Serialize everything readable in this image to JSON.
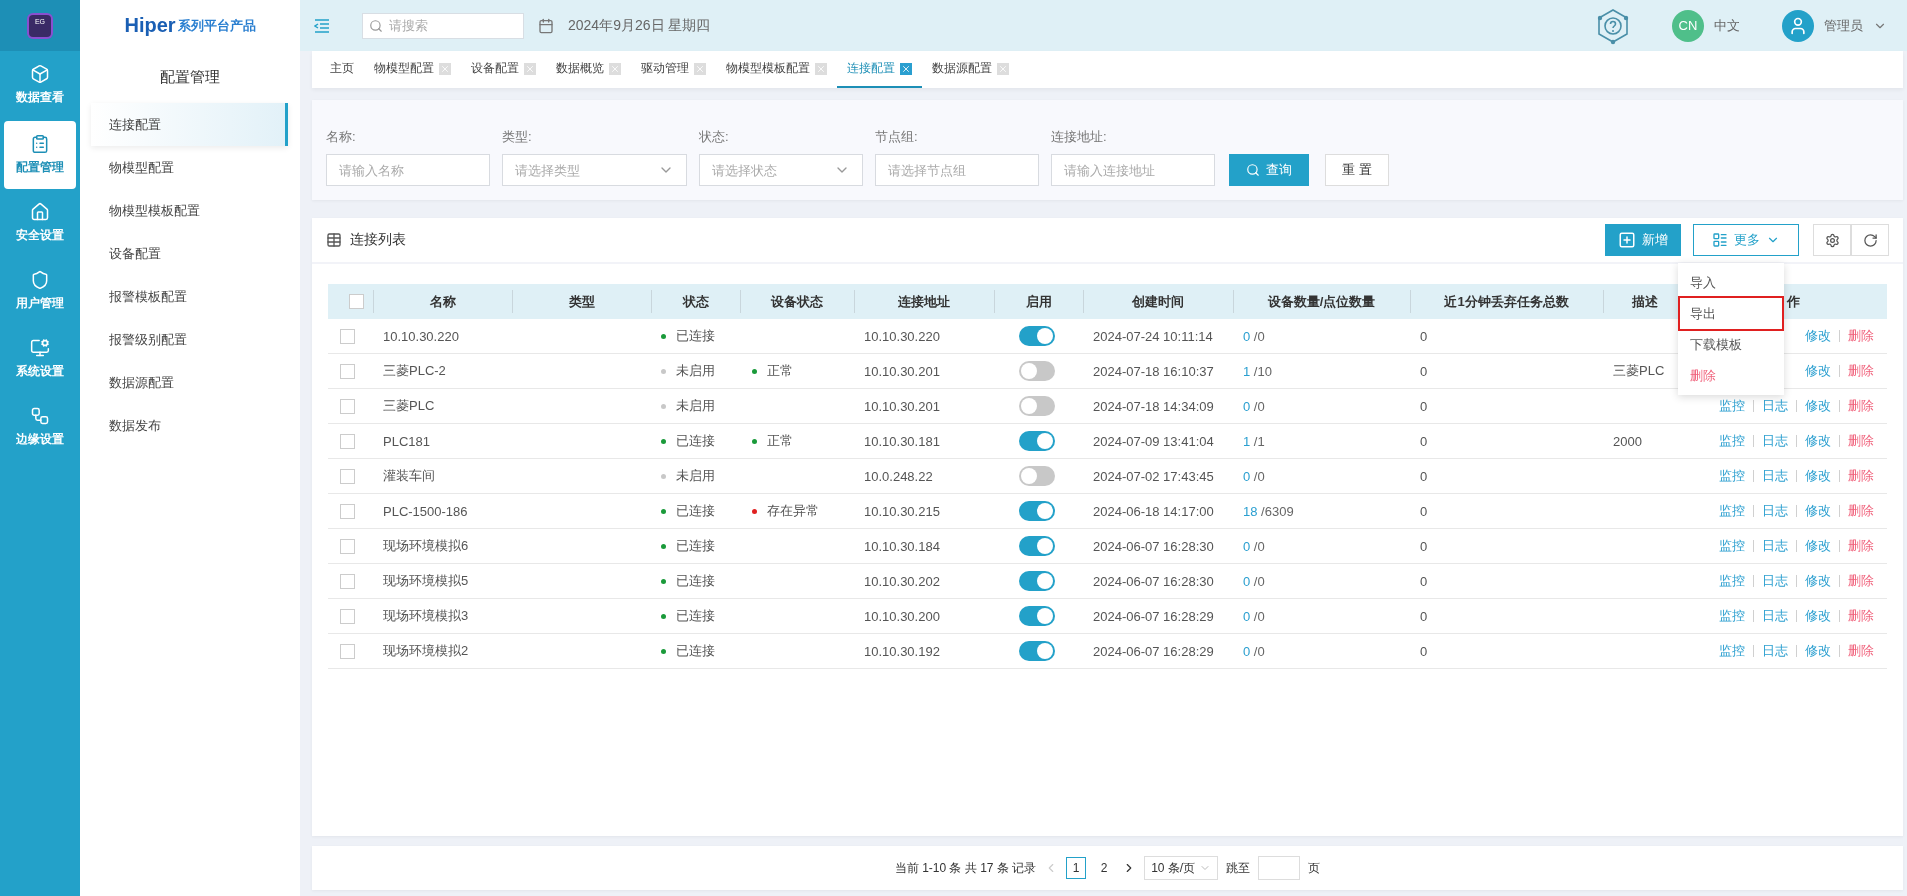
{
  "rail": {
    "logo": "EG",
    "items": [
      {
        "label": "数据查看",
        "selected": false
      },
      {
        "label": "配置管理",
        "selected": true
      },
      {
        "label": "安全设置",
        "selected": false
      },
      {
        "label": "用户管理",
        "selected": false
      },
      {
        "label": "系统设置",
        "selected": false
      },
      {
        "label": "边缘设置",
        "selected": false
      }
    ]
  },
  "sidebar": {
    "brand": "Hiper",
    "brand_suffix": "系列平台产品",
    "title": "配置管理",
    "items": [
      {
        "label": "连接配置",
        "selected": true
      },
      {
        "label": "物模型配置",
        "selected": false
      },
      {
        "label": "物模型模板配置",
        "selected": false
      },
      {
        "label": "设备配置",
        "selected": false
      },
      {
        "label": "报警模板配置",
        "selected": false
      },
      {
        "label": "报警级别配置",
        "selected": false
      },
      {
        "label": "数据源配置",
        "selected": false
      },
      {
        "label": "数据发布",
        "selected": false
      }
    ]
  },
  "header": {
    "search_placeholder": "请搜索",
    "date": "2024年9月26日 星期四",
    "language_badge": "CN",
    "language": "中文",
    "user": "管理员"
  },
  "tabs": [
    {
      "label": "主页",
      "selected": false,
      "closable": false
    },
    {
      "label": "物模型配置",
      "selected": false,
      "closable": true
    },
    {
      "label": "设备配置",
      "selected": false,
      "closable": true
    },
    {
      "label": "数据概览",
      "selected": false,
      "closable": true
    },
    {
      "label": "驱动管理",
      "selected": false,
      "closable": true
    },
    {
      "label": "物模型模板配置",
      "selected": false,
      "closable": true
    },
    {
      "label": "连接配置",
      "selected": true,
      "closable": true
    },
    {
      "label": "数据源配置",
      "selected": false,
      "closable": true
    }
  ],
  "filters": [
    {
      "label": "名称:",
      "placeholder": "请输入名称",
      "kind": "input"
    },
    {
      "label": "类型:",
      "placeholder": "请选择类型",
      "kind": "select"
    },
    {
      "label": "状态:",
      "placeholder": "请选择状态",
      "kind": "select"
    },
    {
      "label": "节点组:",
      "placeholder": "请选择节点组",
      "kind": "input"
    },
    {
      "label": "连接地址:",
      "placeholder": "请输入连接地址",
      "kind": "input"
    }
  ],
  "filter_buttons": [
    {
      "label": "查询",
      "kind": "primary"
    },
    {
      "label": "重 置",
      "kind": "default"
    }
  ],
  "table_card": {
    "title": "连接列表",
    "add_button": "新增",
    "more_button": "更多",
    "more_menu": [
      {
        "label": "导入",
        "kind": "normal",
        "highlighted": false
      },
      {
        "label": "导出",
        "kind": "normal",
        "highlighted": true
      },
      {
        "label": "下载模板",
        "kind": "normal",
        "highlighted": false
      },
      {
        "label": "删除",
        "kind": "danger",
        "highlighted": false
      }
    ]
  },
  "table": {
    "select_all_checked": false,
    "columns": [
      "名称",
      "类型",
      "状态",
      "设备状态",
      "连接地址",
      "启用",
      "创建时间",
      "设备数量/点位数量",
      "近1分钟丢弃任务总数",
      "描述",
      "作"
    ],
    "rows": [
      {
        "checked": false,
        "name": "10.10.30.220",
        "status": {
          "label": "已连接",
          "color": "#1a9a3a"
        },
        "address": "10.10.30.220",
        "enabled": true,
        "created": "2024-07-24 10:11:14",
        "devices": "0",
        "points": "/0",
        "dropped": "0",
        "ops": [
          {
            "label": "修改",
            "kind": "link"
          },
          {
            "label": "删除",
            "kind": "danger"
          }
        ]
      },
      {
        "checked": false,
        "name": "三菱PLC-2",
        "status": {
          "label": "未启用",
          "color": "#c8c8c8"
        },
        "device_status": {
          "label": "正常",
          "color": "#1a9a3a"
        },
        "address": "10.10.30.201",
        "enabled": false,
        "created": "2024-07-18 16:10:37",
        "devices": "1",
        "points": "/10",
        "dropped": "0",
        "description": "三菱PLC",
        "ops": [
          {
            "label": "修改",
            "kind": "link"
          },
          {
            "label": "删除",
            "kind": "danger"
          }
        ]
      },
      {
        "checked": false,
        "name": "三菱PLC",
        "status": {
          "label": "未启用",
          "color": "#c8c8c8"
        },
        "address": "10.10.30.201",
        "enabled": false,
        "created": "2024-07-18 14:34:09",
        "devices": "0",
        "points": "/0",
        "dropped": "0",
        "ops": [
          {
            "label": "监控",
            "kind": "link"
          },
          {
            "label": "日志",
            "kind": "link"
          },
          {
            "label": "修改",
            "kind": "link"
          },
          {
            "label": "删除",
            "kind": "danger"
          }
        ]
      },
      {
        "checked": false,
        "name": "PLC181",
        "status": {
          "label": "已连接",
          "color": "#1a9a3a"
        },
        "device_status": {
          "label": "正常",
          "color": "#1a9a3a"
        },
        "address": "10.10.30.181",
        "enabled": true,
        "created": "2024-07-09 13:41:04",
        "devices": "1",
        "points": "/1",
        "dropped": "0",
        "description": "2000",
        "ops": [
          {
            "label": "监控",
            "kind": "link"
          },
          {
            "label": "日志",
            "kind": "link"
          },
          {
            "label": "修改",
            "kind": "link"
          },
          {
            "label": "删除",
            "kind": "danger"
          }
        ]
      },
      {
        "checked": false,
        "name": "灌装车间",
        "status": {
          "label": "未启用",
          "color": "#c8c8c8"
        },
        "address": "10.0.248.22",
        "enabled": false,
        "created": "2024-07-02 17:43:45",
        "devices": "0",
        "points": "/0",
        "dropped": "0",
        "ops": [
          {
            "label": "监控",
            "kind": "link"
          },
          {
            "label": "日志",
            "kind": "link"
          },
          {
            "label": "修改",
            "kind": "link"
          },
          {
            "label": "删除",
            "kind": "danger"
          }
        ]
      },
      {
        "checked": false,
        "name": "PLC-1500-186",
        "status": {
          "label": "已连接",
          "color": "#1a9a3a"
        },
        "device_status": {
          "label": "存在异常",
          "color": "#e02020"
        },
        "address": "10.10.30.215",
        "enabled": true,
        "created": "2024-06-18 14:17:00",
        "devices": "18",
        "points": "/6309",
        "dropped": "0",
        "ops": [
          {
            "label": "监控",
            "kind": "link"
          },
          {
            "label": "日志",
            "kind": "link"
          },
          {
            "label": "修改",
            "kind": "link"
          },
          {
            "label": "删除",
            "kind": "danger"
          }
        ]
      },
      {
        "checked": false,
        "name": "现场环境模拟6",
        "status": {
          "label": "已连接",
          "color": "#1a9a3a"
        },
        "address": "10.10.30.184",
        "enabled": true,
        "created": "2024-06-07 16:28:30",
        "devices": "0",
        "points": "/0",
        "dropped": "0",
        "ops": [
          {
            "label": "监控",
            "kind": "link"
          },
          {
            "label": "日志",
            "kind": "link"
          },
          {
            "label": "修改",
            "kind": "link"
          },
          {
            "label": "删除",
            "kind": "danger"
          }
        ]
      },
      {
        "checked": false,
        "name": "现场环境模拟5",
        "status": {
          "label": "已连接",
          "color": "#1a9a3a"
        },
        "address": "10.10.30.202",
        "enabled": true,
        "created": "2024-06-07 16:28:30",
        "devices": "0",
        "points": "/0",
        "dropped": "0",
        "ops": [
          {
            "label": "监控",
            "kind": "link"
          },
          {
            "label": "日志",
            "kind": "link"
          },
          {
            "label": "修改",
            "kind": "link"
          },
          {
            "label": "删除",
            "kind": "danger"
          }
        ]
      },
      {
        "checked": false,
        "name": "现场环境模拟3",
        "status": {
          "label": "已连接",
          "color": "#1a9a3a"
        },
        "address": "10.10.30.200",
        "enabled": true,
        "created": "2024-06-07 16:28:29",
        "devices": "0",
        "points": "/0",
        "dropped": "0",
        "ops": [
          {
            "label": "监控",
            "kind": "link"
          },
          {
            "label": "日志",
            "kind": "link"
          },
          {
            "label": "修改",
            "kind": "link"
          },
          {
            "label": "删除",
            "kind": "danger"
          }
        ]
      },
      {
        "checked": false,
        "name": "现场环境模拟2",
        "status": {
          "label": "已连接",
          "color": "#1a9a3a"
        },
        "address": "10.10.30.192",
        "enabled": true,
        "created": "2024-06-07 16:28:29",
        "devices": "0",
        "points": "/0",
        "dropped": "0",
        "ops": [
          {
            "label": "监控",
            "kind": "link"
          },
          {
            "label": "日志",
            "kind": "link"
          },
          {
            "label": "修改",
            "kind": "link"
          },
          {
            "label": "删除",
            "kind": "danger"
          }
        ]
      }
    ]
  },
  "pagination": {
    "summary": "当前 1-10 条 共 17 条 记录",
    "pages": [
      {
        "label": "1",
        "selected": true
      },
      {
        "label": "2",
        "selected": false
      }
    ],
    "page_size": "10 条/页",
    "jump_label": "跳至",
    "page_suffix": "页"
  }
}
